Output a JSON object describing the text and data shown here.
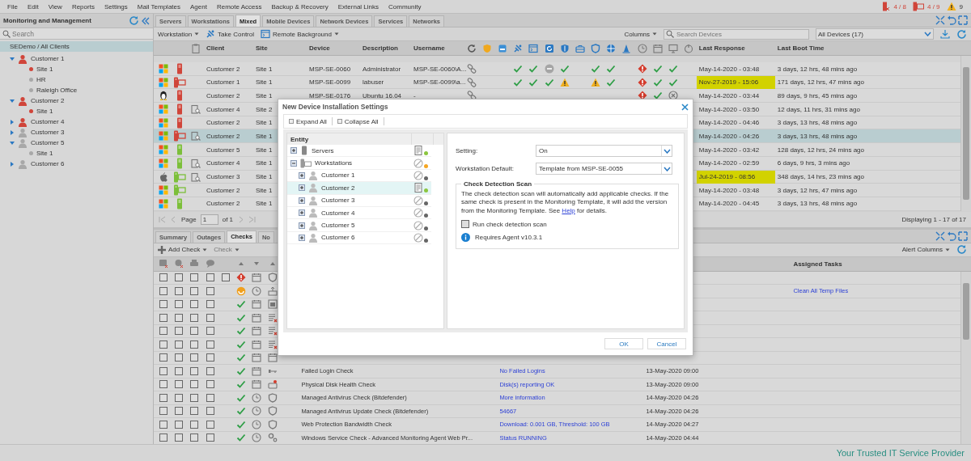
{
  "menu": [
    "File",
    "Edit",
    "View",
    "Reports",
    "Settings",
    "Mail Templates",
    "Agent",
    "Remote Access",
    "Backup & Recovery",
    "External Links",
    "Community"
  ],
  "status_counts": [
    {
      "kind": "server-alert",
      "text": "4 / 8"
    },
    {
      "kind": "workstation-alert",
      "text": "4 / 9"
    },
    {
      "kind": "warning",
      "text": "9"
    }
  ],
  "sidebar": {
    "title": "Monitoring and Management",
    "search_placeholder": "Search",
    "root": {
      "label": "SEDemo / All Clients",
      "selected": true
    },
    "clients": [
      {
        "label": "Customer 1",
        "color": "#d0453a",
        "expanded": true,
        "selected": false,
        "children": [
          {
            "label": "Site 1",
            "color": "#d0453a",
            "selected": false
          },
          {
            "label": "HR",
            "color": "#a8a8a8",
            "selected": false
          },
          {
            "label": "Raleigh Office",
            "color": "#a8a8a8",
            "selected": false
          }
        ]
      },
      {
        "label": "Customer 2",
        "color": "#d0453a",
        "expanded": true,
        "selected": false,
        "children": [
          {
            "label": "Site 1",
            "color": "#d0453a",
            "selected": false
          }
        ]
      },
      {
        "label": "Customer 4",
        "color": "#d0453a",
        "expanded": false,
        "selected": false
      },
      {
        "label": "Customer 3",
        "color": "#a8a8a8",
        "expanded": false,
        "selected": false
      },
      {
        "label": "Customer 5",
        "color": "#a8a8a8",
        "expanded": true,
        "selected": false,
        "children": [
          {
            "label": "Site 1",
            "color": "#a8a8a8",
            "selected": false
          }
        ]
      },
      {
        "label": "Customer 6",
        "color": "#a8a8a8",
        "expanded": false,
        "selected": false
      }
    ]
  },
  "device_tabs": [
    {
      "label": "Servers",
      "selected": false
    },
    {
      "label": "Workstations",
      "selected": false
    },
    {
      "label": "Mixed",
      "selected": true
    },
    {
      "label": "Mobile Devices",
      "selected": false
    },
    {
      "label": "Network Devices",
      "selected": false
    },
    {
      "label": "Services",
      "selected": false
    },
    {
      "label": "Networks",
      "selected": false
    }
  ],
  "device_toolbar": {
    "buttons": [
      {
        "label": "Workstation",
        "kind": "menu"
      },
      {
        "label": "Take Control",
        "kind": "remote"
      },
      {
        "label": "Remote Background",
        "kind": "console"
      }
    ],
    "columns_label": "Columns",
    "search_placeholder": "Search Devices",
    "filter_value": "All Devices (17)"
  },
  "table": {
    "columns": [
      "Client",
      "Site",
      "Device",
      "Description",
      "Username",
      "Last Response",
      "Last Boot Time"
    ],
    "rows": [
      {
        "os": {
          "kind": "windows"
        },
        "device": {
          "kind": "server",
          "color": "#d0453a"
        },
        "flagged": false,
        "client": "Customer 2",
        "site": "Site 1",
        "device_name": "MSP-SE-0060",
        "description": "Administrator",
        "username": "MSP-SE-0060\\A...",
        "checks": [
          {
            "kind": "linked"
          },
          {
            "kind": "none"
          },
          {
            "kind": "none"
          },
          {
            "kind": "ok"
          },
          {
            "kind": "ok"
          },
          {
            "kind": "off"
          },
          {
            "kind": "ok"
          },
          {
            "kind": "none"
          },
          {
            "kind": "ok"
          },
          {
            "kind": "ok"
          },
          {
            "kind": "none"
          },
          {
            "kind": "fail"
          },
          {
            "kind": "ok"
          },
          {
            "kind": "ok"
          },
          {
            "kind": "none"
          }
        ],
        "last_response": "May-14-2020 - 03:48",
        "overdue": false,
        "last_boot": "3 days, 12 hrs, 48 mins ago",
        "selected": false
      },
      {
        "os": {
          "kind": "windows"
        },
        "device": {
          "kind": "workstation",
          "color": "#d0453a"
        },
        "flagged": false,
        "client": "Customer 1",
        "site": "Site 1",
        "device_name": "MSP-SE-0099",
        "description": "labuser",
        "username": "MSP-SE-0099\\a...",
        "checks": [
          {
            "kind": "linked"
          },
          {
            "kind": "none"
          },
          {
            "kind": "none"
          },
          {
            "kind": "ok"
          },
          {
            "kind": "ok"
          },
          {
            "kind": "ok"
          },
          {
            "kind": "warn"
          },
          {
            "kind": "none"
          },
          {
            "kind": "warn"
          },
          {
            "kind": "ok"
          },
          {
            "kind": "none"
          },
          {
            "kind": "fail"
          },
          {
            "kind": "ok"
          },
          {
            "kind": "ok"
          },
          {
            "kind": "none"
          }
        ],
        "last_response": "Nov-27-2019 - 15:06",
        "overdue": true,
        "last_boot": "171 days, 12 hrs, 47 mins ago",
        "selected": false
      },
      {
        "os": {
          "kind": "linux"
        },
        "device": {
          "kind": "server",
          "color": "#d0453a"
        },
        "flagged": false,
        "client": "Customer 2",
        "site": "Site 1",
        "device_name": "MSP-SE-0176",
        "description": "Ubuntu 16.04",
        "username": "-",
        "checks": [
          {
            "kind": "linked"
          },
          {
            "kind": "none"
          },
          {
            "kind": "none"
          },
          {
            "kind": "none"
          },
          {
            "kind": "none"
          },
          {
            "kind": "none"
          },
          {
            "kind": "none"
          },
          {
            "kind": "none"
          },
          {
            "kind": "none"
          },
          {
            "kind": "none"
          },
          {
            "kind": "none"
          },
          {
            "kind": "fail"
          },
          {
            "kind": "ok"
          },
          {
            "kind": "stopped"
          },
          {
            "kind": "none"
          }
        ],
        "last_response": "May-14-2020 - 03:44",
        "overdue": false,
        "last_boot": "89 days, 9 hrs, 45 mins ago",
        "selected": false
      },
      {
        "os": {
          "kind": "windows"
        },
        "device": {
          "kind": "server",
          "color": "#d0453a"
        },
        "flagged": true,
        "client": "Customer 4",
        "site": "Site 2",
        "last_response": "May-14-2020 - 03:50",
        "overdue": false,
        "last_boot": "12 days, 11 hrs, 31 mins ago",
        "selected": false
      },
      {
        "os": {
          "kind": "windows"
        },
        "device": {
          "kind": "server",
          "color": "#d0453a"
        },
        "flagged": false,
        "client": "Customer 2",
        "site": "Site 1",
        "last_response": "May-14-2020 - 04:46",
        "overdue": false,
        "last_boot": "3 days, 13 hrs, 48 mins ago",
        "selected": false
      },
      {
        "os": {
          "kind": "windows"
        },
        "device": {
          "kind": "workstation",
          "color": "#d0453a"
        },
        "flagged": true,
        "client": "Customer 2",
        "site": "Site 1",
        "last_response": "May-14-2020 - 04:26",
        "overdue": false,
        "last_boot": "3 days, 13 hrs, 48 mins ago",
        "selected": true
      },
      {
        "os": {
          "kind": "windows"
        },
        "device": {
          "kind": "server",
          "color": "#7cbf3a"
        },
        "flagged": false,
        "client": "Customer 5",
        "site": "Site 1",
        "last_response": "May-14-2020 - 03:42",
        "overdue": false,
        "last_boot": "128 days, 12 hrs, 24 mins ago",
        "selected": false
      },
      {
        "os": {
          "kind": "windows"
        },
        "device": {
          "kind": "server",
          "color": "#7cbf3a"
        },
        "flagged": true,
        "client": "Customer 4",
        "site": "Site 1",
        "last_response": "May-14-2020 - 02:59",
        "overdue": false,
        "last_boot": "6 days, 9 hrs, 3 mins ago",
        "selected": false
      },
      {
        "os": {
          "kind": "apple"
        },
        "device": {
          "kind": "workstation",
          "color": "#7cbf3a"
        },
        "flagged": true,
        "client": "Customer 3",
        "site": "Site 1",
        "last_response": "Jul-24-2019 - 08:56",
        "overdue": true,
        "last_boot": "348 days, 14 hrs, 23 mins ago",
        "selected": false
      },
      {
        "os": {
          "kind": "windows"
        },
        "device": {
          "kind": "workstation",
          "color": "#7cbf3a"
        },
        "flagged": false,
        "client": "Customer 2",
        "site": "Site 1",
        "last_response": "May-14-2020 - 03:48",
        "overdue": false,
        "last_boot": "3 days, 12 hrs, 47 mins ago",
        "selected": false
      },
      {
        "os": {
          "kind": "windows"
        },
        "device": {
          "kind": "server",
          "color": "#7cbf3a"
        },
        "flagged": false,
        "client": "Customer 2",
        "site": "Site 1",
        "last_response": "May-14-2020 - 04:45",
        "overdue": false,
        "last_boot": "3 days, 13 hrs, 48 mins ago",
        "selected": false
      }
    ]
  },
  "pager": {
    "page_label": "Page",
    "page_value": "1",
    "of_label": "of 1",
    "summary": "Displaying 1 - 17 of 17"
  },
  "detail_tabs": [
    {
      "label": "Summary",
      "selected": false
    },
    {
      "label": "Outages",
      "selected": false
    },
    {
      "label": "Checks",
      "selected": true
    },
    {
      "label": "No",
      "selected": false
    }
  ],
  "checks_toolbar": {
    "add_label": "Add Check",
    "check_label": "Check",
    "check_disabled": true,
    "alert_columns": "Alert Columns"
  },
  "checks_table": {
    "columns": [
      "Assigned Tasks"
    ],
    "rows": [
      {
        "boxes": [
          false,
          false,
          false,
          false,
          false
        ],
        "status": {
          "kind": "fail"
        },
        "schedule": {
          "kind": "daily"
        },
        "type": {
          "kind": "shield"
        }
      },
      {
        "boxes": [
          false,
          false,
          false,
          false
        ],
        "status": {
          "kind": "pending"
        },
        "schedule": {
          "kind": "continuous"
        },
        "type": {
          "kind": "network"
        },
        "task": "Clean All Temp Files"
      },
      {
        "boxes": [
          false,
          false,
          false,
          false
        ],
        "status": {
          "kind": "ok"
        },
        "schedule": {
          "kind": "daily"
        },
        "type": {
          "kind": "window"
        }
      },
      {
        "boxes": [
          false,
          false,
          false,
          false
        ],
        "status": {
          "kind": "ok"
        },
        "schedule": {
          "kind": "daily"
        },
        "type": {
          "kind": "log"
        }
      },
      {
        "boxes": [
          false,
          false,
          false,
          false
        ],
        "status": {
          "kind": "ok"
        },
        "schedule": {
          "kind": "daily"
        },
        "type": {
          "kind": "log"
        }
      },
      {
        "boxes": [
          false,
          false,
          false,
          false
        ],
        "status": {
          "kind": "ok"
        },
        "schedule": {
          "kind": "daily"
        },
        "type": {
          "kind": "log"
        }
      },
      {
        "boxes": [
          false,
          false,
          false,
          false
        ],
        "status": {
          "kind": "ok"
        },
        "schedule": {
          "kind": "daily"
        },
        "type": {
          "kind": "calendar"
        }
      },
      {
        "boxes": [
          false,
          false,
          false,
          false
        ],
        "status": {
          "kind": "ok"
        },
        "schedule": {
          "kind": "daily"
        },
        "type": {
          "kind": "key"
        },
        "description": "Failed Login Check",
        "extra": "No Failed Logins",
        "date": "13-May-2020 09:00"
      },
      {
        "boxes": [
          false,
          false,
          false,
          false
        ],
        "status": {
          "kind": "ok"
        },
        "schedule": {
          "kind": "daily"
        },
        "type": {
          "kind": "disk"
        },
        "description": "Physical Disk Health Check",
        "extra": "Disk(s) reporting OK",
        "date": "13-May-2020 09:00"
      },
      {
        "boxes": [
          false,
          false,
          false,
          false
        ],
        "status": {
          "kind": "ok"
        },
        "schedule": {
          "kind": "continuous"
        },
        "type": {
          "kind": "shield"
        },
        "description": "Managed Antivirus Check (Bitdefender)",
        "extra": "More information",
        "date": "14-May-2020 04:26"
      },
      {
        "boxes": [
          false,
          false,
          false,
          false
        ],
        "status": {
          "kind": "ok"
        },
        "schedule": {
          "kind": "continuous"
        },
        "type": {
          "kind": "shield"
        },
        "description": "Managed Antivirus Update Check (Bitdefender)",
        "extra": "54667",
        "date": "14-May-2020 04:26"
      },
      {
        "boxes": [
          false,
          false,
          false,
          false
        ],
        "status": {
          "kind": "ok"
        },
        "schedule": {
          "kind": "continuous"
        },
        "type": {
          "kind": "shield"
        },
        "description": "Web Protection Bandwidth Check",
        "extra": "Download: 0.001 GB, Threshold: 100 GB",
        "date": "14-May-2020 04:27"
      },
      {
        "boxes": [
          false,
          false,
          false,
          false
        ],
        "status": {
          "kind": "ok"
        },
        "schedule": {
          "kind": "continuous"
        },
        "type": {
          "kind": "gears"
        },
        "description": "Windows Service Check - Advanced Monitoring Agent Web Pr...",
        "extra": "Status RUNNING",
        "date": "14-May-2020 04:44"
      }
    ]
  },
  "dialog": {
    "title": "New Device Installation Settings",
    "toolbar": [
      "Expand All",
      "Collapse All"
    ],
    "tree_header": "Entity",
    "tree": [
      {
        "label": "Servers",
        "kind": "server",
        "expanded": false,
        "setting": {
          "kind": "template"
        },
        "color": "#8cc63f",
        "selected": false
      },
      {
        "label": "Workstations",
        "kind": "workstation",
        "expanded": true,
        "setting": {
          "kind": "off"
        },
        "color": "#f5a623",
        "selected": false,
        "children": [
          {
            "label": "Customer 1",
            "kind": "client",
            "expanded": false,
            "setting": {
              "kind": "off"
            },
            "color": "#666666",
            "selected": false
          },
          {
            "label": "Customer 2",
            "kind": "client",
            "expanded": false,
            "setting": {
              "kind": "template"
            },
            "color": "#8cc63f",
            "selected": true
          },
          {
            "label": "Customer 3",
            "kind": "client",
            "expanded": false,
            "setting": {
              "kind": "off"
            },
            "color": "#666666",
            "selected": false
          },
          {
            "label": "Customer 4",
            "kind": "client",
            "expanded": false,
            "setting": {
              "kind": "off"
            },
            "color": "#666666",
            "selected": false
          },
          {
            "label": "Customer 5",
            "kind": "client",
            "expanded": false,
            "setting": {
              "kind": "off"
            },
            "color": "#666666",
            "selected": false
          },
          {
            "label": "Customer 6",
            "kind": "client",
            "expanded": false,
            "setting": {
              "kind": "off"
            },
            "color": "#666666",
            "selected": false
          }
        ]
      }
    ],
    "fields": [
      {
        "label": "Setting:",
        "value": "On"
      },
      {
        "label": "Workstation Default:",
        "value": "Template from MSP-SE-0055"
      }
    ],
    "scan": {
      "title": "Check Detection Scan",
      "text": "The check detection scan will automatically add applicable checks. If the same check is present in the Monitoring Template, it will add the version from the Monitoring Template. See ",
      "link": "Help",
      "text_after": " for details.",
      "checkbox": {
        "label": "Run check detection scan",
        "checked": false
      },
      "note": "Requires Agent v10.3.1"
    },
    "buttons": [
      "OK",
      "Cancel"
    ]
  },
  "footer": {
    "tagline": "Your Trusted IT Service Provider"
  }
}
